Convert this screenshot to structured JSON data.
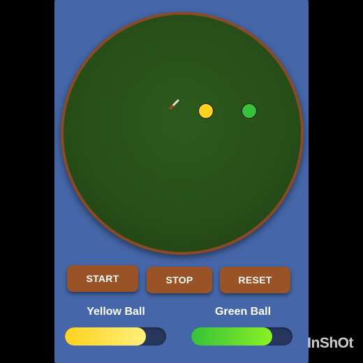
{
  "controls": {
    "start_label": "START",
    "stop_label": "STOP",
    "reset_label": "RESET"
  },
  "balls": {
    "yellow": {
      "label": "Yellow Ball",
      "color": "#ffd21f",
      "progress": 0.8
    },
    "green": {
      "label": "Green Ball",
      "color": "#36c23a",
      "progress": 0.8
    }
  },
  "colors": {
    "panel": "#4566a8",
    "table_rim": "#8a4a24",
    "table_felt": "#2a5419",
    "button": "#9a5326",
    "bar_track": "#27365c"
  },
  "icons": {
    "cue": "cue-stick-icon"
  },
  "watermark": "InShOt"
}
